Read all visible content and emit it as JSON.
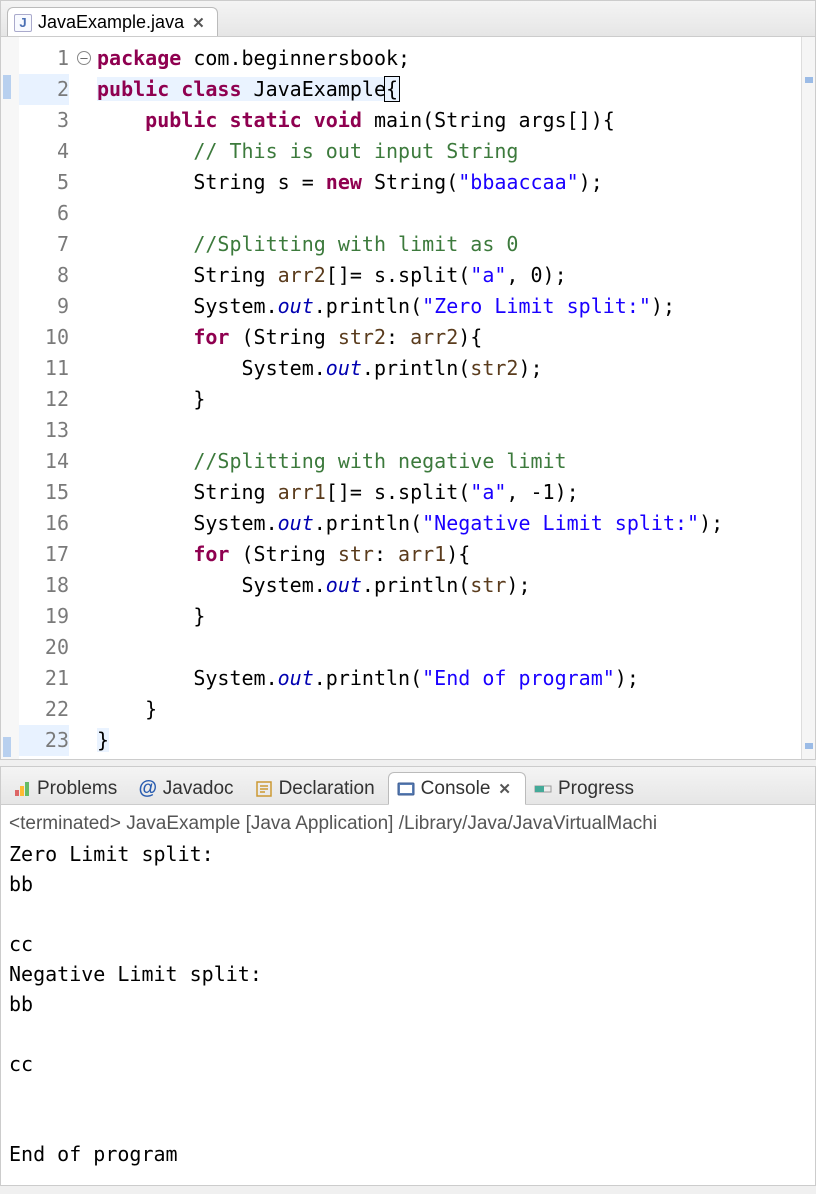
{
  "editor": {
    "tab_filename": "JavaExample.java",
    "lines": {
      "count": 23
    }
  },
  "code": {
    "l1_pkg": "package",
    "l1_name": " com.beginnersbook;",
    "l2_pub": "public",
    "l2_class": "class",
    "l2_name": " JavaExample",
    "l2_brace": "{",
    "l3_pub": "public",
    "l3_static": "static",
    "l3_void": "void",
    "l3_rest": " main(String args[]){",
    "l4_cmt": "// This is out input String",
    "l5_a": "String s = ",
    "l5_new": "new",
    "l5_b": " String(",
    "l5_str": "\"bbaaccaa\"",
    "l5_c": ");",
    "l7_cmt": "//Splitting with limit as 0",
    "l8_a": "String ",
    "l8_var": "arr2",
    "l8_b": "[]= s.split(",
    "l8_str": "\"a\"",
    "l8_c": ", 0);",
    "l9_a": "System.",
    "l9_out": "out",
    "l9_b": ".println(",
    "l9_str": "\"Zero Limit split:\"",
    "l9_c": ");",
    "l10_for": "for",
    "l10_a": " (String ",
    "l10_v1": "str2",
    "l10_b": ": ",
    "l10_v2": "arr2",
    "l10_c": "){",
    "l11_a": "System.",
    "l11_out": "out",
    "l11_b": ".println(",
    "l11_v": "str2",
    "l11_c": ");",
    "l12": "}",
    "l14_cmt": "//Splitting with negative limit",
    "l15_a": "String ",
    "l15_var": "arr1",
    "l15_b": "[]= s.split(",
    "l15_str": "\"a\"",
    "l15_c": ", -1);",
    "l16_a": "System.",
    "l16_out": "out",
    "l16_b": ".println(",
    "l16_str": "\"Negative Limit split:\"",
    "l16_c": ");",
    "l17_for": "for",
    "l17_a": " (String ",
    "l17_v1": "str",
    "l17_b": ": ",
    "l17_v2": "arr1",
    "l17_c": "){",
    "l18_a": "System.",
    "l18_out": "out",
    "l18_b": ".println(",
    "l18_v": "str",
    "l18_c": ");",
    "l19": "}",
    "l21_a": "System.",
    "l21_out": "out",
    "l21_b": ".println(",
    "l21_str": "\"End of program\"",
    "l21_c": ");",
    "l22": "}",
    "l23": "}"
  },
  "bottom_tabs": {
    "problems": "Problems",
    "javadoc": "Javadoc",
    "declaration": "Declaration",
    "console": "Console",
    "progress": "Progress"
  },
  "console": {
    "status": "<terminated> JavaExample [Java Application] /Library/Java/JavaVirtualMachi",
    "out1": "Zero Limit split:",
    "out2": "bb",
    "out3": "",
    "out4": "cc",
    "out5": "Negative Limit split:",
    "out6": "bb",
    "out7": "",
    "out8": "cc",
    "out9": "",
    "out10": "",
    "out11": "End of program"
  },
  "line_numbers": [
    "1",
    "2",
    "3",
    "4",
    "5",
    "6",
    "7",
    "8",
    "9",
    "10",
    "11",
    "12",
    "13",
    "14",
    "15",
    "16",
    "17",
    "18",
    "19",
    "20",
    "21",
    "22",
    "23"
  ]
}
